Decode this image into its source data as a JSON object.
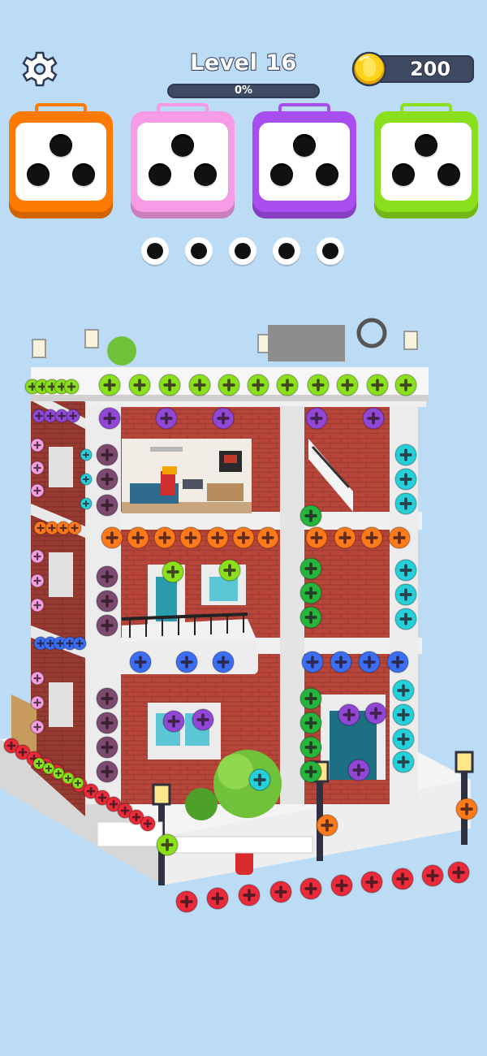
{
  "hud": {
    "level_label": "Level 16",
    "progress_text": "0%",
    "progress_value": 0,
    "coins": "200",
    "settings_icon": "gear-icon",
    "coin_icon": "coin-icon"
  },
  "screw_boxes": [
    {
      "color": "orange",
      "hex": "#ff7a00"
    },
    {
      "color": "pink",
      "hex": "#f79be6"
    },
    {
      "color": "purple",
      "hex": "#a84ef0"
    },
    {
      "color": "lime",
      "hex": "#8be01d"
    }
  ],
  "slots": {
    "count": 5,
    "filled": 0
  },
  "screw_colors": {
    "lime": "#8be01d",
    "purple": "#9147d6",
    "pink": "#f29ee0",
    "cyan": "#25d0da",
    "orange": "#ff7a1a",
    "green": "#25b43c",
    "blue": "#3b6ef2",
    "red": "#ea2b3a",
    "plum": "#7b4a6e"
  }
}
